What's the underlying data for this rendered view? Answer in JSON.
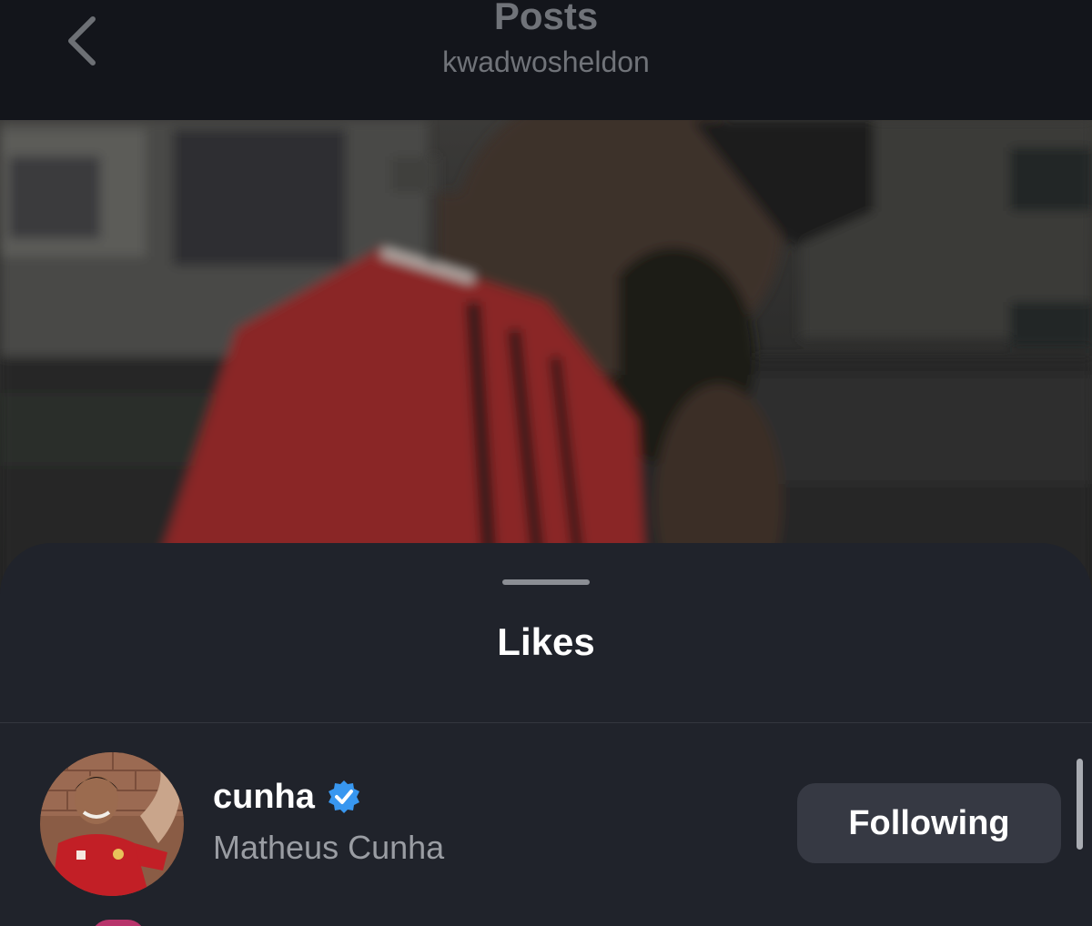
{
  "header": {
    "title": "Posts",
    "subtitle": "kwadwosheldon",
    "back_icon": "chevron-left-icon"
  },
  "sheet": {
    "title": "Likes"
  },
  "likes": [
    {
      "username": "cunha",
      "verified": true,
      "full_name": "Matheus Cunha",
      "button_label": "Following"
    }
  ],
  "colors": {
    "header_bg": "#13151b",
    "sheet_bg": "#20232b",
    "button_bg": "#363943",
    "verified_blue": "#3897f0",
    "muted_text": "#9a9da3"
  }
}
